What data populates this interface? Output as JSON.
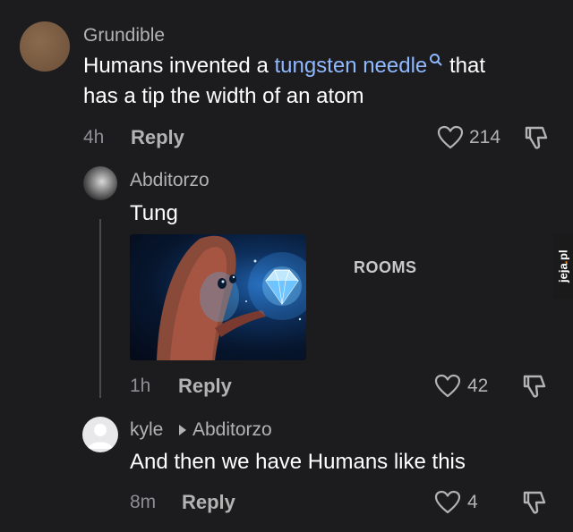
{
  "comments": [
    {
      "username": "Grundible",
      "text_before": "Humans invented a ",
      "link_text": "tungsten needle",
      "text_after_line1": " that",
      "text_line2": "has a tip the width of an atom",
      "time": "4h",
      "reply_label": "Reply",
      "likes": "214"
    },
    {
      "username": "Abditorzo",
      "text": "Tung",
      "image_caption": "ROOMS",
      "time": "1h",
      "reply_label": "Reply",
      "likes": "42"
    },
    {
      "username": "kyle",
      "reply_to": "Abditorzo",
      "text": "And then we have Humans like this",
      "time": "8m",
      "reply_label": "Reply",
      "likes": "4"
    }
  ],
  "watermark": {
    "part1": "jeja",
    "dot": ".",
    "part2": "pl"
  },
  "icons": {
    "search": "search-icon",
    "like": "heart-outline-icon",
    "dislike": "thumbs-down-icon",
    "reply_arrow": "triangle-right-icon"
  },
  "colors": {
    "background": "#1c1c1e",
    "link": "#8fb8ff"
  }
}
